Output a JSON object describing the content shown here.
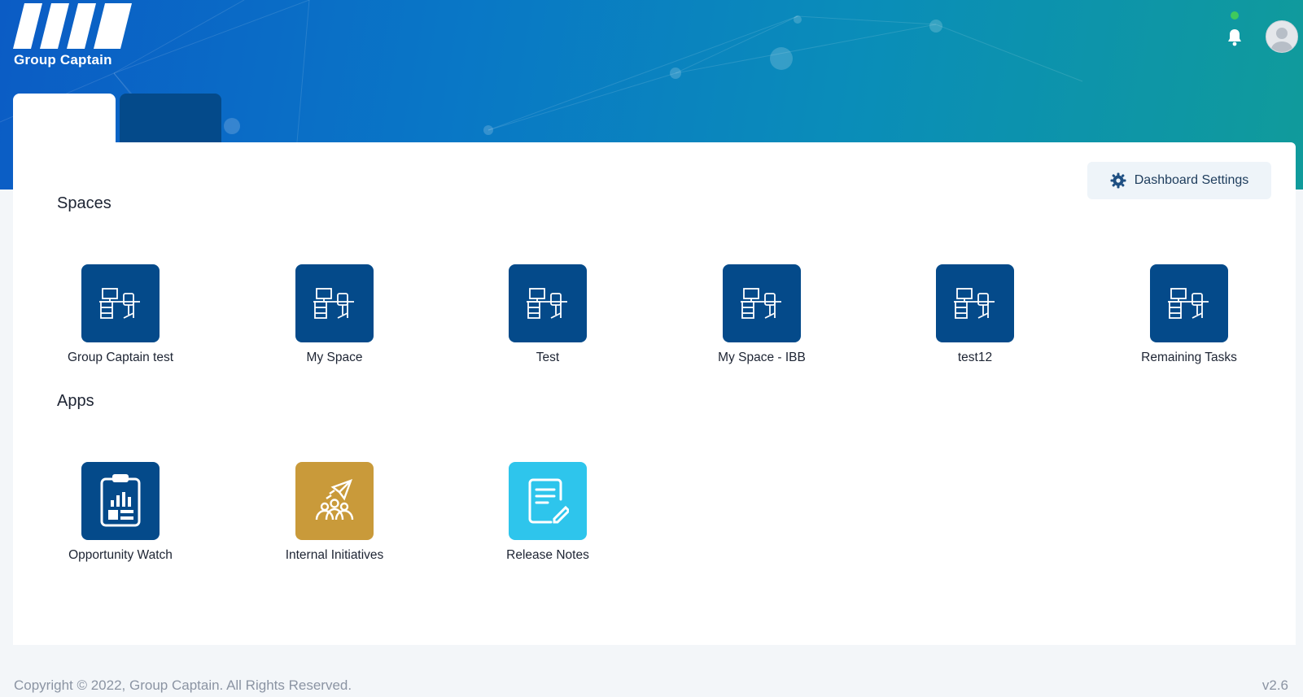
{
  "brand": {
    "name": "Group Captain"
  },
  "header": {
    "notification_icon": "bell-icon",
    "status": "online",
    "avatar_icon": "user-avatar-icon"
  },
  "tabs": [
    {
      "label": ""
    },
    {
      "label": ""
    }
  ],
  "toolbar": {
    "settings_label": "Dashboard Settings",
    "settings_icon": "gear-icon"
  },
  "spaces": {
    "title": "Spaces",
    "items": [
      {
        "label": "Group Captain test",
        "icon": "desk-workstation-icon"
      },
      {
        "label": "My Space",
        "icon": "desk-workstation-icon"
      },
      {
        "label": "Test",
        "icon": "desk-workstation-icon"
      },
      {
        "label": "My Space - IBB",
        "icon": "desk-workstation-icon"
      },
      {
        "label": "test12",
        "icon": "desk-workstation-icon"
      },
      {
        "label": "Remaining Tasks",
        "icon": "desk-workstation-icon"
      }
    ]
  },
  "apps": {
    "title": "Apps",
    "items": [
      {
        "label": "Opportunity Watch",
        "icon": "clipboard-chart-icon",
        "color": "#044a8a"
      },
      {
        "label": "Internal Initiatives",
        "icon": "team-launch-icon",
        "color": "#c99a3a"
      },
      {
        "label": "Release Notes",
        "icon": "document-edit-icon",
        "color": "#2ec5ec"
      }
    ]
  },
  "colors": {
    "space_tile": "#044a8a",
    "accent": "#0b5cc5"
  },
  "footer": {
    "copyright": "Copyright © 2022, Group Captain. All Rights Reserved.",
    "version": "v2.6"
  }
}
